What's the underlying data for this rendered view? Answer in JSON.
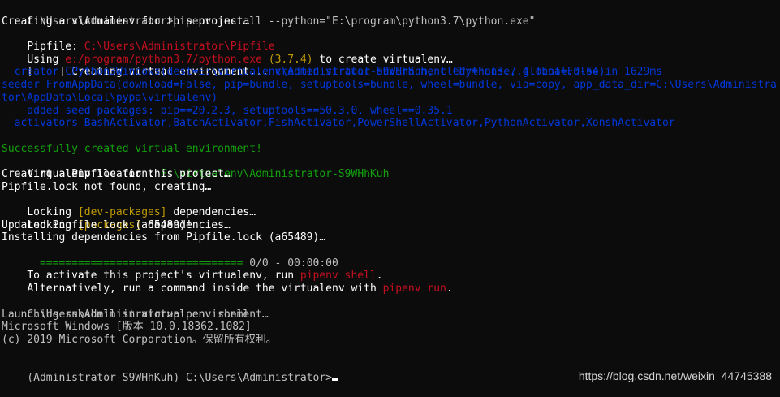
{
  "terminal": {
    "l1_prompt": "C:\\Users\\Administrator>",
    "l1_cmd": "pipenv install --python=\"E:\\program\\python3.7\\python.exe\"",
    "l2": "Creating a virtualenv for this project…",
    "l3_label": "Pipfile: ",
    "l3_path": "C:\\Users\\Administrator\\Pipfile",
    "l4_a": "Using ",
    "l4_path": "e:/program/python3.7/python.exe",
    "l4_ver": " (3.7.4)",
    "l4_b": " to create virtualenv…",
    "l5_spinner": "[    ] Creating virtual environment...",
    "l5_created": "created virtual environment CPython3.7.4.final.0-64 in 1629ms",
    "l6_creator": "  creator CPython3Windows(dest=E:\\virtualenv\\Administrator-S9WHhKuh, clear=False, global=False)",
    "l7_seeder": "  seeder FromAppData(download=False, pip=bundle, setuptools=bundle, wheel=bundle, via=copy, app_data_dir=C:\\Users\\Administrator\\AppData\\Local\\pypa\\virtualenv)",
    "l9_added": "    added seed packages: pip==20.2.3, setuptools==50.3.0, wheel==0.35.1",
    "l10_activators": "  activators BashActivator,BatchActivator,FishActivator,PowerShellActivator,PythonActivator,XonshActivator",
    "l12_success": "Successfully created virtual environment!",
    "l13_label": "Virtualenv location: ",
    "l13_path": "E:\\virtualenv\\Administrator-S9WHhKuh",
    "l14": "Creating a Pipfile for this project…",
    "l15": "Pipfile.lock not found, creating…",
    "l16_a": "Locking ",
    "l16_tag": "[dev-packages]",
    "l16_b": " dependencies…",
    "l17_a": "Locking ",
    "l17_tag": "[packages]",
    "l17_b": " dependencies…",
    "l18": "Updated Pipfile.lock (a65489)!",
    "l19": "Installing dependencies from Pipfile.lock (a65489)…",
    "l20_bar": "  ================================",
    "l20_count": " 0/0 - 00:00:00",
    "l21_a": "To activate this project's virtualenv, run ",
    "l21_cmd": "pipenv shell",
    "l21_b": ".",
    "l22_a": "Alternatively, run a command inside the virtualenv with ",
    "l22_cmd": "pipenv run",
    "l22_b": ".",
    "l24_prompt": "C:\\Users\\Administrator>",
    "l24_cmd": "pipenv shell",
    "l25": "Launching subshell in virtual environment…",
    "l26": "Microsoft Windows [版本 10.0.18362.1082]",
    "l27": "(c) 2019 Microsoft Corporation。保留所有权利。",
    "l29_prompt": "(Administrator-S9WHhKuh) C:\\Users\\Administrator>"
  },
  "watermark": "https://blog.csdn.net/weixin_44745388",
  "colors": {
    "background": "#0c0c0c",
    "text": "#c0c0c0",
    "red": "#c50f1f",
    "yellow": "#c19c00",
    "green": "#13a10e",
    "blue": "#0037da"
  }
}
